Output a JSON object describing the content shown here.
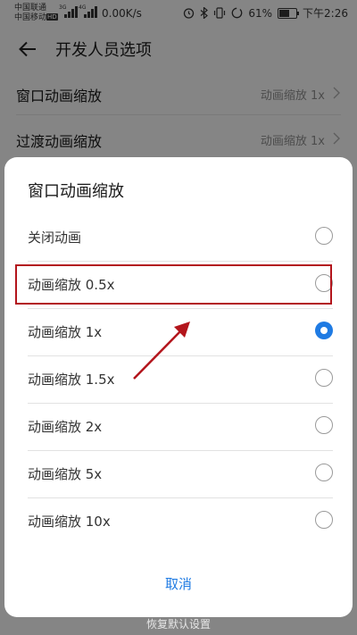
{
  "status_bar": {
    "carrier1": "中国联通",
    "carrier2": "中国移动",
    "hd": "HD",
    "net1": "3G",
    "net2": "4G",
    "speed": "0.00K/s",
    "battery": "61%",
    "battery_level": 0.61,
    "time": "下午2:26",
    "icons": [
      "alarm-icon",
      "bluetooth-icon",
      "vibrate-icon",
      "data-saver-icon"
    ]
  },
  "header": {
    "title": "开发人员选项",
    "back_icon": "back-arrow-icon"
  },
  "settings": [
    {
      "label": "窗口动画缩放",
      "value": "动画缩放 1x"
    },
    {
      "label": "过渡动画缩放",
      "value": "动画缩放 1x"
    }
  ],
  "restore_label": "恢复默认设置",
  "dialog": {
    "title": "窗口动画缩放",
    "options": [
      {
        "label": "关闭动画",
        "selected": false
      },
      {
        "label": "动画缩放 0.5x",
        "selected": false
      },
      {
        "label": "动画缩放 1x",
        "selected": true
      },
      {
        "label": "动画缩放 1.5x",
        "selected": false
      },
      {
        "label": "动画缩放 2x",
        "selected": false
      },
      {
        "label": "动画缩放 5x",
        "selected": false
      },
      {
        "label": "动画缩放 10x",
        "selected": false
      }
    ],
    "cancel_label": "取消"
  },
  "colors": {
    "accent": "#1f7be3",
    "annotation": "#b3151c"
  }
}
